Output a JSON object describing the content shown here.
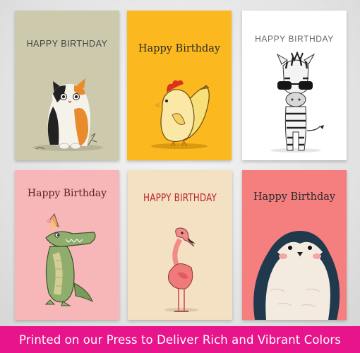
{
  "cards": [
    {
      "title": "HAPPY BIRTHDAY",
      "animal": "cat",
      "background": "#ccc9ad"
    },
    {
      "title": "Happy Birthday",
      "animal": "chicken-banana",
      "background": "#fbb81f"
    },
    {
      "title": "HAPPY BIRTHDAY",
      "animal": "zebra-sunglasses",
      "background": "#ffffff"
    },
    {
      "title": "Happy Birthday",
      "animal": "crocodile-party-hat",
      "background": "#f7b6b8"
    },
    {
      "title": "HAPPY BIRTHDAY",
      "animal": "flamingo",
      "background": "#f4e0c2"
    },
    {
      "title": "Happy Birthday",
      "animal": "penguin",
      "background": "#f57f7f"
    }
  ],
  "banner": {
    "text": "Printed on our Press to Deliver Rich and Vibrant Colors",
    "color": "#e8148c"
  }
}
